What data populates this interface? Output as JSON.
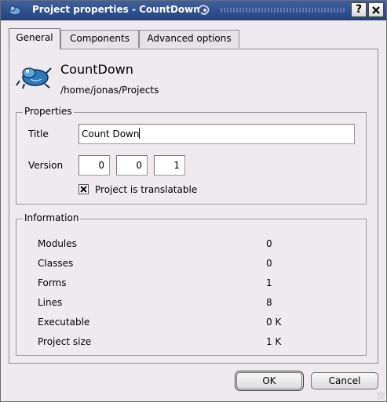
{
  "window": {
    "title": "Project properties - CountDown",
    "help_button": "?",
    "close_button": "X"
  },
  "tabs": [
    {
      "label": "General"
    },
    {
      "label": "Components"
    },
    {
      "label": "Advanced options"
    }
  ],
  "project": {
    "name": "CountDown",
    "path": "/home/jonas/Projects"
  },
  "properties": {
    "group_label": "Properties",
    "title_label": "Title",
    "title_value": "Count Down",
    "version_label": "Version",
    "version": [
      "0",
      "0",
      "1"
    ],
    "translatable_label": "Project is translatable",
    "translatable_checked": true
  },
  "information": {
    "group_label": "Information",
    "rows": [
      {
        "label": "Modules",
        "value": "0"
      },
      {
        "label": "Classes",
        "value": "0"
      },
      {
        "label": "Forms",
        "value": "1"
      },
      {
        "label": "Lines",
        "value": "8"
      },
      {
        "label": "Executable",
        "value": "0 K"
      },
      {
        "label": "Project size",
        "value": "1 K"
      }
    ]
  },
  "buttons": {
    "ok": "OK",
    "cancel": "Cancel"
  }
}
